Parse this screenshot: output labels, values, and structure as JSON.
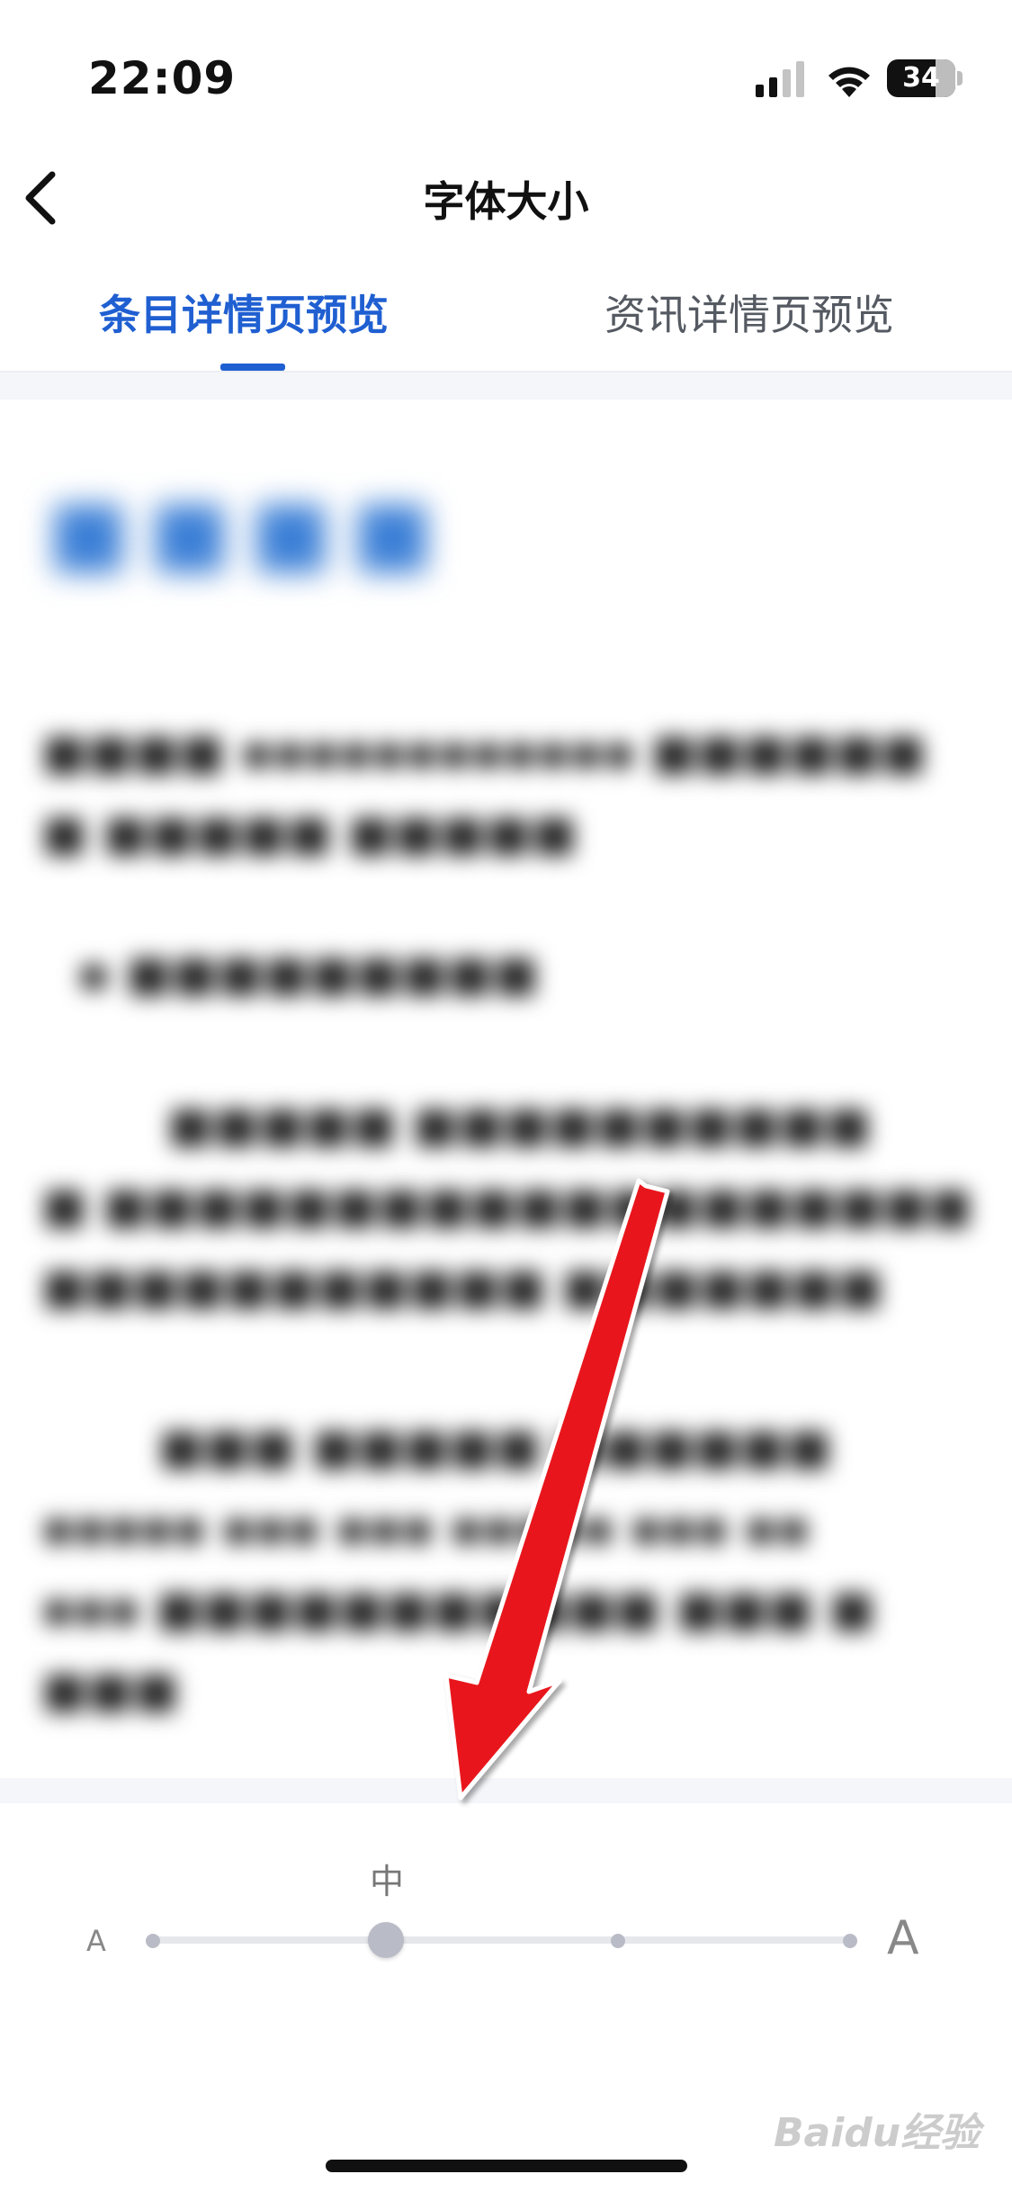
{
  "status_bar": {
    "time": "22:09",
    "battery": "34"
  },
  "nav": {
    "title": "字体大小"
  },
  "tabs": [
    {
      "label": "条目详情页预览",
      "active": true
    },
    {
      "label": "资讯详情页预览",
      "active": false
    }
  ],
  "font_size_control": {
    "current_label": "中",
    "small_label": "A",
    "large_label": "A",
    "steps": 4,
    "selected_step": 2
  },
  "watermark": "Baidu经验",
  "colors": {
    "accent": "#1f5fd1",
    "annotation": "#e8141b"
  }
}
